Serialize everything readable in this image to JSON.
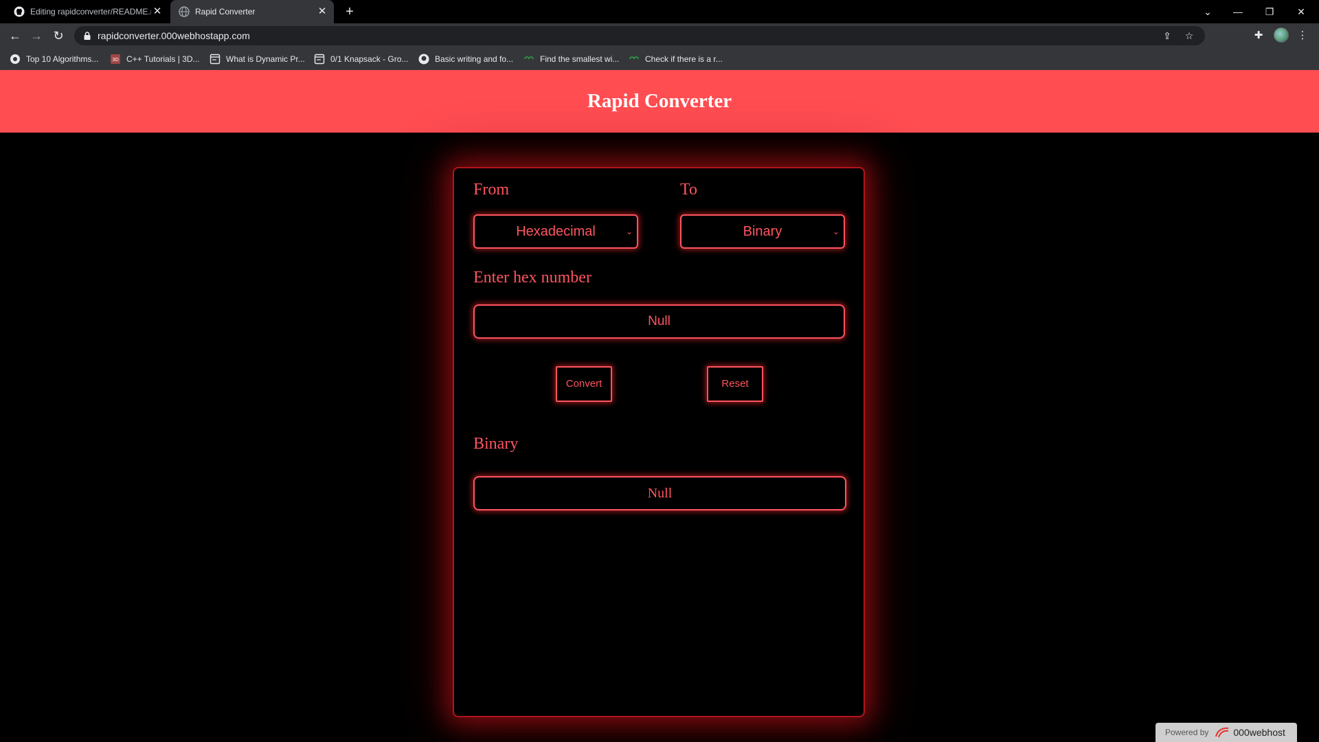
{
  "browser": {
    "tabs": [
      {
        "title": "Editing rapidconverter/README.md",
        "active": false
      },
      {
        "title": "Rapid Converter",
        "active": true
      }
    ],
    "url": "rapidconverter.000webhostapp.com",
    "bookmarks": [
      "Top 10 Algorithms...",
      "C++ Tutorials | 3D...",
      "What is Dynamic Pr...",
      "0/1 Knapsack - Gro...",
      "Basic writing and fo...",
      "Find the smallest wi...",
      "Check if there is a r..."
    ]
  },
  "page": {
    "title": "Rapid Converter",
    "from_label": "From",
    "to_label": "To",
    "from_value": "Hexadecimal",
    "to_value": "Binary",
    "input_label": "Enter hex number",
    "input_placeholder": "Null",
    "convert_button": "Convert",
    "reset_button": "Reset",
    "output_label": "Binary",
    "output_value": "Null"
  },
  "footer": {
    "powered_by": "Powered by",
    "host_brand": "000webhost"
  },
  "colors": {
    "header_bg": "#ff4d52",
    "accent": "#ff5560",
    "panel_border": "#b3141c"
  }
}
